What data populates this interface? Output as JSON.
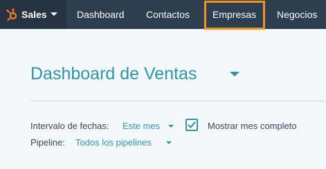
{
  "topbar": {
    "brand_label": "Sales",
    "nav": [
      {
        "label": "Dashboard"
      },
      {
        "label": "Contactos"
      },
      {
        "label": "Empresas"
      },
      {
        "label": "Negocios"
      }
    ],
    "highlighted_item": "Empresas"
  },
  "page": {
    "title": "Dashboard de Ventas"
  },
  "filters": {
    "interval_label": "Intervalo de fechas:",
    "interval_value": "Este mes",
    "show_full_month_label": "Mostrar mes completo",
    "show_full_month_checked": true,
    "pipeline_label": "Pipeline:",
    "pipeline_value": "Todos los pipelines"
  },
  "colors": {
    "topbar_bg": "#2d3e50",
    "brand_bg": "#253342",
    "accent": "#2e95a8",
    "logo": "#f57722",
    "highlight": "#f5901e",
    "page_bg": "#f5f8fa"
  },
  "icons": {
    "logo": "hubspot-sprocket-icon",
    "brand_caret": "caret-down-icon",
    "title_caret": "caret-down-icon",
    "checkbox": "check-icon"
  }
}
